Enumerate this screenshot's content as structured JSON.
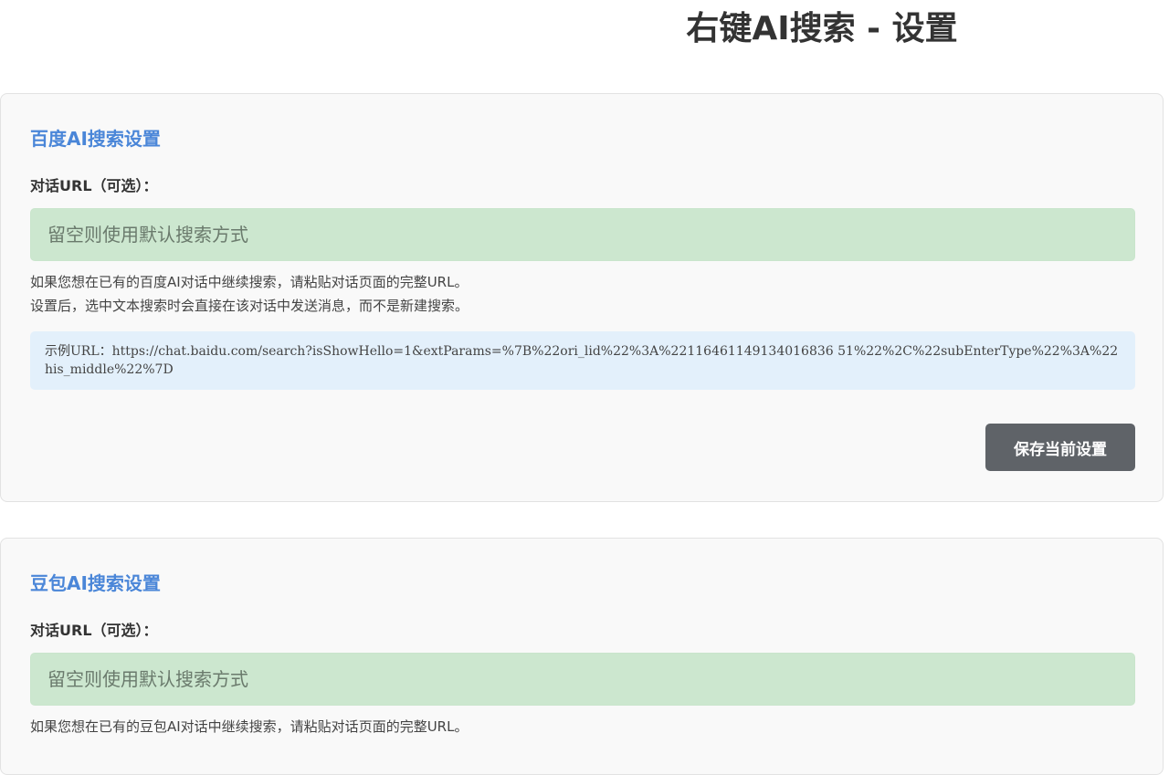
{
  "page": {
    "title": "右键AI搜索 - 设置"
  },
  "baidu": {
    "title": "百度AI搜索设置",
    "url_label": "对话URL（可选）：",
    "url_placeholder": "留空则使用默认搜索方式",
    "url_value": "",
    "help_line1": "如果您想在已有的百度AI对话中继续搜索，请粘贴对话页面的完整URL。",
    "help_line2": "设置后，选中文本搜索时会直接在该对话中发送消息，而不是新建搜索。",
    "example": "示例URL：https://chat.baidu.com/search?isShowHello=1&extParams=%7B%22ori_lid%22%3A%22116461149134016836 51%22%2C%22subEnterType%22%3A%22his_middle%22%7D",
    "save_label": "保存当前设置"
  },
  "doubao": {
    "title": "豆包AI搜索设置",
    "url_label": "对话URL（可选）：",
    "url_placeholder": "留空则使用默认搜索方式",
    "url_value": "",
    "help_line1": "如果您想在已有的豆包AI对话中继续搜索，请粘贴对话页面的完整URL。"
  }
}
